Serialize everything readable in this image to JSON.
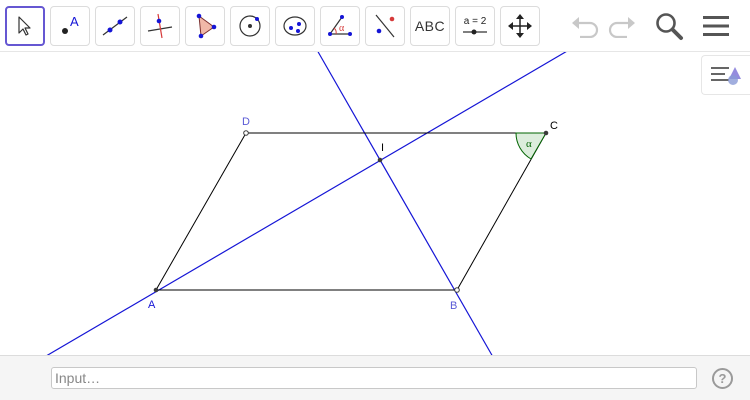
{
  "toolbar": {
    "tools": [
      {
        "name": "move-tool",
        "label": ""
      },
      {
        "name": "point-tool",
        "label": "A"
      },
      {
        "name": "line-tool",
        "label": ""
      },
      {
        "name": "perpendicular-line-tool",
        "label": ""
      },
      {
        "name": "polygon-tool",
        "label": ""
      },
      {
        "name": "circle-tool",
        "label": ""
      },
      {
        "name": "ellipse-tool",
        "label": ""
      },
      {
        "name": "angle-tool",
        "label": "α"
      },
      {
        "name": "reflect-tool",
        "label": ""
      },
      {
        "name": "text-tool",
        "label": "ABC"
      },
      {
        "name": "slider-tool",
        "label": "a = 2"
      },
      {
        "name": "move-graphics-view-tool",
        "label": ""
      }
    ],
    "undo_icon": "undo-icon",
    "redo_icon": "redo-icon",
    "search_icon": "search-icon",
    "menu_icon": "menu-icon"
  },
  "graphics": {
    "points": [
      {
        "name": "A",
        "label": "A"
      },
      {
        "name": "B",
        "label": "B"
      },
      {
        "name": "C",
        "label": "C"
      },
      {
        "name": "D",
        "label": "D"
      },
      {
        "name": "I",
        "label": "I"
      }
    ],
    "angle_label": "α",
    "colors": {
      "segments": "#000000",
      "lines": "#1515d6",
      "point_label": "#5a5ad6",
      "angle_fill": "#d6ead6",
      "angle_stroke": "#006400"
    }
  },
  "inputbar": {
    "placeholder": "Input…",
    "help_label": "?"
  }
}
